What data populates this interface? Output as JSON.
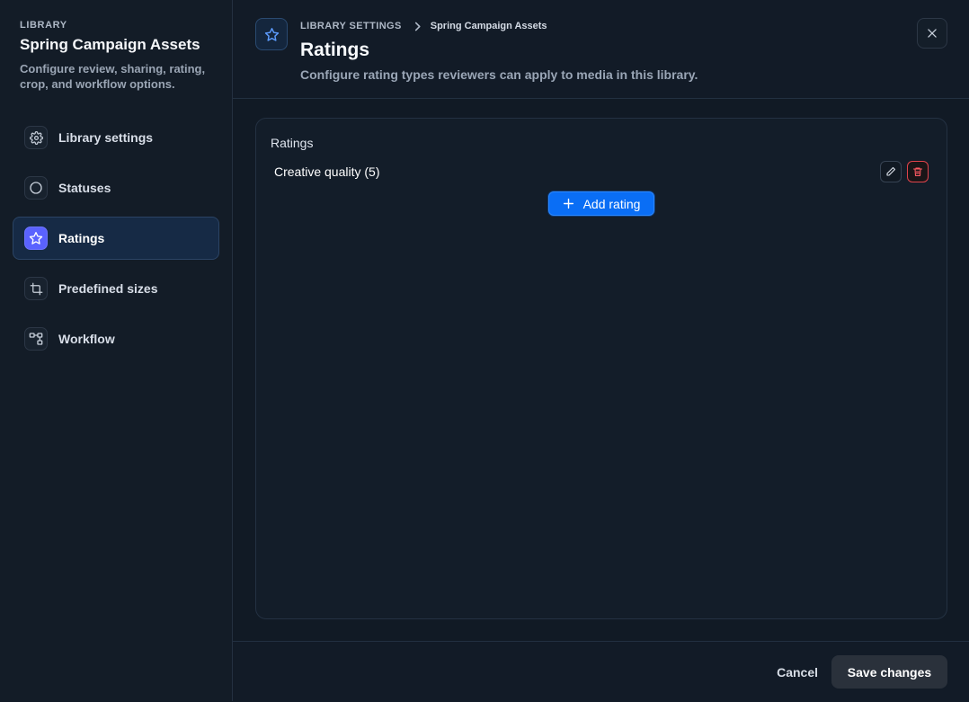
{
  "sidebar": {
    "eyebrow": "LIBRARY",
    "title": "Spring Campaign Assets",
    "description": "Configure review, sharing, rating, crop, and workflow options.",
    "items": [
      {
        "label": "Library settings",
        "icon": "gear-icon"
      },
      {
        "label": "Statuses",
        "icon": "circle-icon"
      },
      {
        "label": "Ratings",
        "icon": "star-icon",
        "active": true
      },
      {
        "label": "Predefined sizes",
        "icon": "crop-icon"
      },
      {
        "label": "Workflow",
        "icon": "workflow-icon"
      }
    ]
  },
  "header": {
    "breadcrumb": [
      "LIBRARY SETTINGS",
      "Spring Campaign Assets"
    ],
    "title": "Ratings",
    "subtitle": "Configure rating types reviewers can apply to media in this library.",
    "icon": "star-icon"
  },
  "ratings": {
    "section_label": "Ratings",
    "items": [
      {
        "name": "Creative quality (5)"
      }
    ],
    "add_label": "Add rating"
  },
  "footer": {
    "cancel_label": "Cancel",
    "save_label": "Save changes"
  },
  "colors": {
    "accent": "#0a6ef5",
    "active_nav_icon": "#5a62ff",
    "danger": "#e0434b",
    "background": "#111a25"
  }
}
